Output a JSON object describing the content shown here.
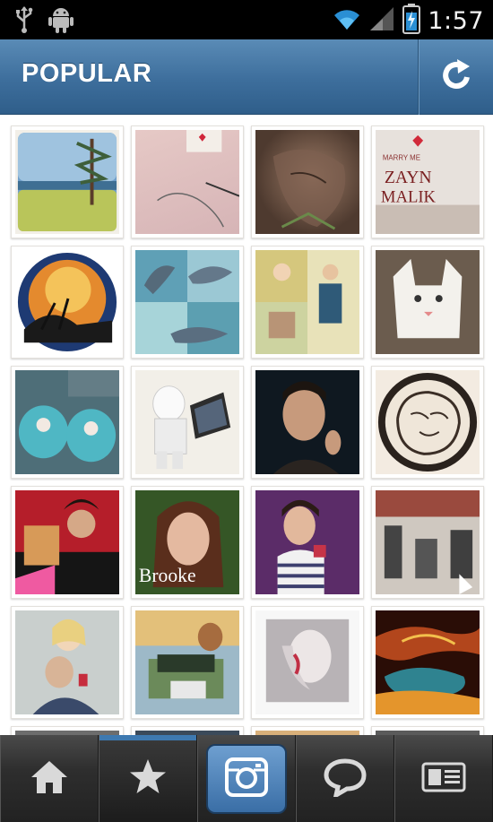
{
  "status_bar": {
    "time": "1:57",
    "left_icons": [
      "usb-icon",
      "android-debug-icon"
    ],
    "right_icons": [
      "wifi-icon",
      "signal-icon",
      "battery-icon"
    ]
  },
  "header": {
    "title": "POPULAR",
    "refresh_icon": "refresh-icon",
    "background_color": "#3d6e9c"
  },
  "feed": {
    "tiles": [
      {
        "id": "photo-1",
        "caption": ""
      },
      {
        "id": "photo-2",
        "caption": ""
      },
      {
        "id": "photo-3",
        "caption": ""
      },
      {
        "id": "photo-4",
        "caption": "MARRY ME ZAYN MALIK"
      },
      {
        "id": "photo-5",
        "caption": ""
      },
      {
        "id": "photo-6",
        "caption": ""
      },
      {
        "id": "photo-7",
        "caption": ""
      },
      {
        "id": "photo-8",
        "caption": ""
      },
      {
        "id": "photo-9",
        "caption": ""
      },
      {
        "id": "photo-10",
        "caption": ""
      },
      {
        "id": "photo-11",
        "caption": ""
      },
      {
        "id": "photo-12",
        "caption": ""
      },
      {
        "id": "photo-13",
        "caption": ""
      },
      {
        "id": "photo-14",
        "caption": "Brooke"
      },
      {
        "id": "photo-15",
        "caption": ""
      },
      {
        "id": "photo-16",
        "caption": ""
      },
      {
        "id": "photo-17",
        "caption": ""
      },
      {
        "id": "photo-18",
        "caption": ""
      },
      {
        "id": "photo-19",
        "caption": ""
      },
      {
        "id": "photo-20",
        "caption": ""
      }
    ]
  },
  "tab_bar": {
    "tabs": [
      {
        "name": "home",
        "icon": "home-icon",
        "selected": false
      },
      {
        "name": "popular",
        "icon": "star-icon",
        "selected": true
      },
      {
        "name": "camera",
        "icon": "camera-icon",
        "selected": false
      },
      {
        "name": "news",
        "icon": "speech-bubble-icon",
        "selected": false
      },
      {
        "name": "profile",
        "icon": "profile-card-icon",
        "selected": false
      }
    ],
    "accent_color": "#3e79b0"
  }
}
